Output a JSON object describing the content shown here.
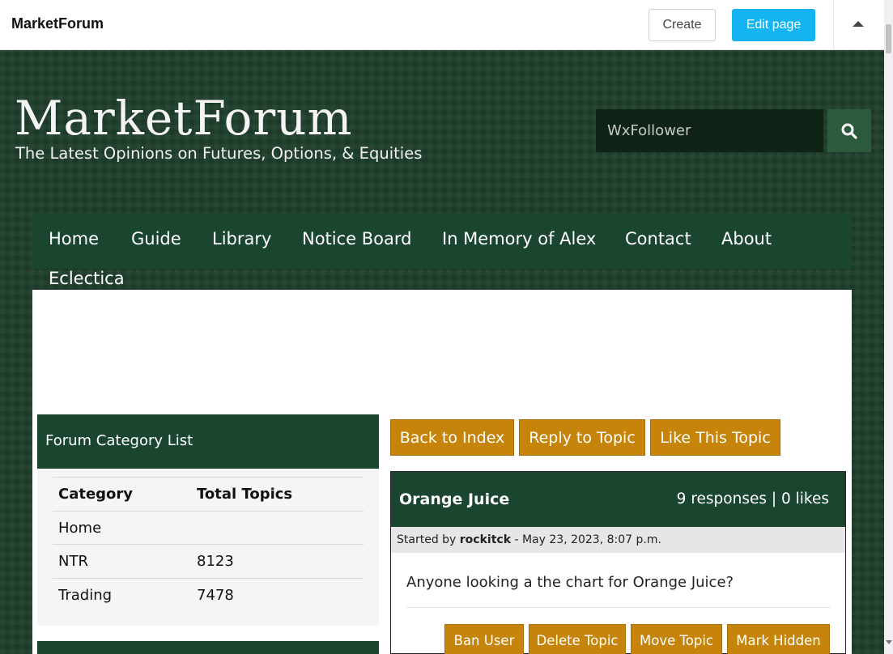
{
  "admin_bar": {
    "brand": "MarketForum",
    "create_label": "Create",
    "edit_label": "Edit page",
    "brand_color": "#14b4f2"
  },
  "header": {
    "site_title": "MarketForum",
    "tagline": "The Latest Opinions on Futures, Options, & Equities",
    "search_value": "WxFollower"
  },
  "nav": {
    "items": [
      "Home",
      "Guide",
      "Library",
      "Notice Board",
      "In Memory of Alex",
      "Contact",
      "About",
      "Eclectica"
    ]
  },
  "category_list": {
    "title": "Forum Category List",
    "columns": [
      "Category",
      "Total Topics"
    ],
    "rows": [
      {
        "category": "Home",
        "topics": ""
      },
      {
        "category": "NTR",
        "topics": "8123"
      },
      {
        "category": "Trading",
        "topics": "7478"
      }
    ]
  },
  "actions": {
    "back": "Back to Index",
    "reply": "Reply to Topic",
    "like": "Like This Topic"
  },
  "topic": {
    "title": "Orange Juice",
    "stats": "9 responses | 0 likes",
    "started_prefix": "Started by",
    "author": "rockitck",
    "date": "- May 23, 2023, 8:07 p.m.",
    "body": "Anyone looking a the chart for Orange Juice?"
  },
  "moderation": {
    "ban": "Ban User",
    "delete": "Delete Topic",
    "move": "Move Topic",
    "hide": "Mark Hidden"
  },
  "colors": {
    "forest": "#1a4630",
    "gold": "#c6850a"
  }
}
